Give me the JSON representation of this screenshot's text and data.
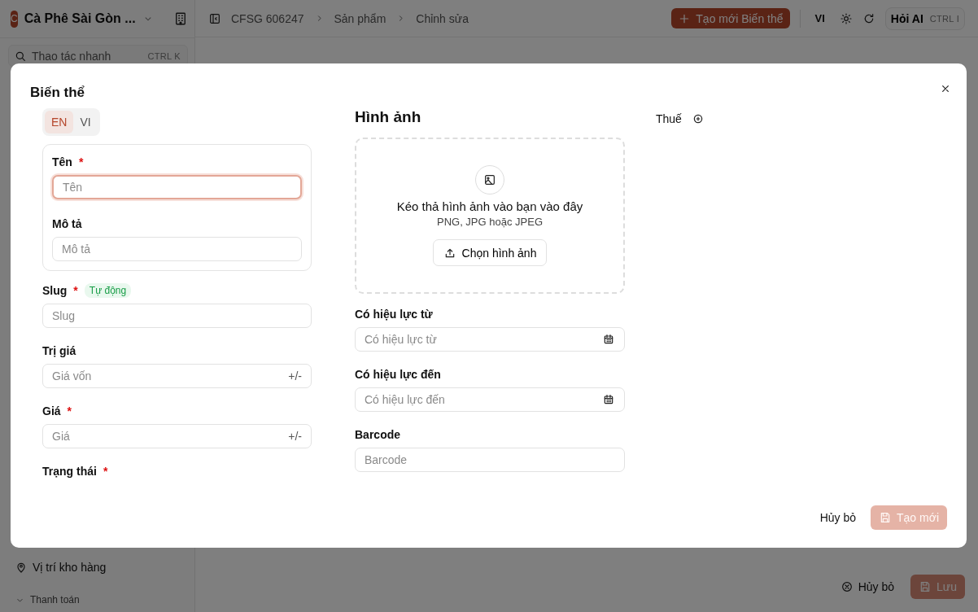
{
  "app": {
    "workspace": {
      "initial": "C",
      "name": "Cà Phê Sài Gòn ..."
    },
    "quick_action": {
      "placeholder": "Thao tác nhanh",
      "shortcut": "CTRL K"
    },
    "breadcrumb": [
      "CFSG 606247",
      "Sản phẩm",
      "Chỉnh sửa"
    ],
    "create_button": "Tạo mới Biến thể",
    "language": "VI",
    "ai_button": {
      "label": "Hỏi AI",
      "shortcut": "CTRL I"
    },
    "sidebar_items": [
      {
        "kind": "link",
        "label": "Vị trí kho hàng"
      },
      {
        "kind": "group",
        "label": "Thanh toán",
        "expanded": true
      }
    ],
    "footer": {
      "cancel": "Hủy bỏ",
      "save": {
        "label": "Lưu",
        "disabled": true
      }
    }
  },
  "dialog": {
    "title": "Biến thể",
    "language_tabs": [
      {
        "label": "EN",
        "selected": true
      },
      {
        "label": "VI",
        "selected": false
      }
    ],
    "translated_fields": [
      {
        "label": "Tên",
        "required_mark": "*",
        "placeholder": "Tên",
        "focused": true
      },
      {
        "label": "Mô tả",
        "placeholder": "Mô tả",
        "focused": false
      }
    ],
    "fields": [
      {
        "label": "Slug",
        "required_mark": "*",
        "badge": "Tự động",
        "placeholder": "Slug"
      },
      {
        "label": "Trị giá",
        "placeholder": "Giá vốn",
        "suffix": "+/-"
      },
      {
        "label": "Giá",
        "required_mark": "*",
        "placeholder": "Giá",
        "suffix": "+/-"
      },
      {
        "label": "Trạng thái",
        "required_mark": "*"
      }
    ],
    "image": {
      "heading": "Hình ảnh",
      "drop_text": "Kéo thả hình ảnh vào bạn vào đây",
      "hint": "PNG, JPG hoặc JPEG",
      "button": "Chọn hình ảnh"
    },
    "side_fields": [
      {
        "kind": "date",
        "label": "Có hiệu lực từ",
        "placeholder": "Có hiệu lực từ"
      },
      {
        "kind": "date",
        "label": "Có hiệu lực đến",
        "placeholder": "Có hiệu lực đến"
      },
      {
        "kind": "text",
        "label": "Barcode",
        "placeholder": "Barcode"
      }
    ],
    "tax": {
      "label": "Thuế"
    },
    "cancel_button": "Hủy bỏ",
    "create_button": {
      "label": "Tạo mới",
      "disabled": true
    }
  }
}
